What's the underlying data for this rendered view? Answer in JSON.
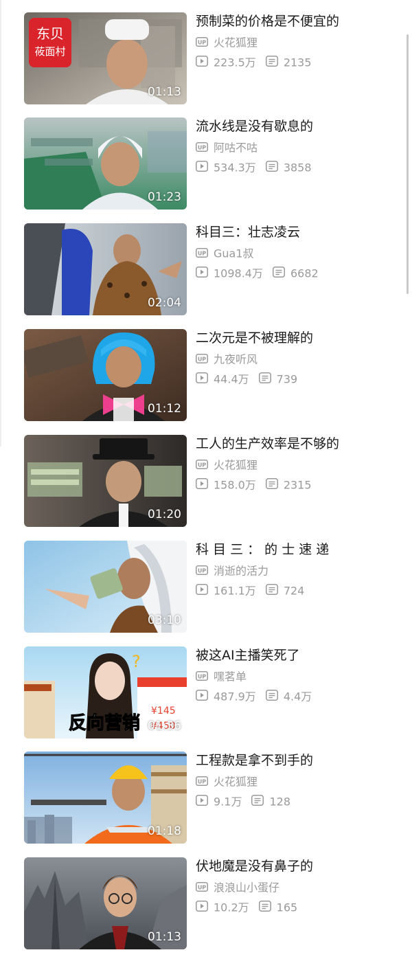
{
  "colors": {
    "title": "#1a1a1a",
    "meta": "#9a9a9a",
    "duration_text": "#ffffff"
  },
  "icons": {
    "uploader": "up-badge-icon",
    "plays": "play-count-icon",
    "comments": "danmaku-count-icon"
  },
  "videos": [
    {
      "title": "预制菜的价格是不便宜的",
      "author": "火花狐狸",
      "plays": "223.5万",
      "comments": "2135",
      "duration": "01:13",
      "thumb_text": "东贝 莜面村"
    },
    {
      "title": "流水线是没有歇息的",
      "author": "阿咕不咕",
      "plays": "534.3万",
      "comments": "3858",
      "duration": "01:23"
    },
    {
      "title": "科目三：壮志凌云",
      "author": "Gua1叔",
      "plays": "1098.4万",
      "comments": "6682",
      "duration": "02:04"
    },
    {
      "title": "二次元是不被理解的",
      "author": "九夜听风",
      "plays": "44.4万",
      "comments": "739",
      "duration": "01:12"
    },
    {
      "title": "工人的生产效率是不够的",
      "author": "火花狐狸",
      "plays": "158.0万",
      "comments": "2315",
      "duration": "01:20"
    },
    {
      "title": "科 目 三 ： 的 士 速 递",
      "author": "消逝的活力",
      "plays": "161.1万",
      "comments": "724",
      "duration": "03:10"
    },
    {
      "title": "被这AI主播笑死了",
      "author": "嘿茗单",
      "plays": "487.9万",
      "comments": "4.4万",
      "duration": "01:36",
      "thumb_text": "反向营销"
    },
    {
      "title": "工程款是拿不到手的",
      "author": "火花狐狸",
      "plays": "9.1万",
      "comments": "128",
      "duration": "01:18"
    },
    {
      "title": "伏地魔是没有鼻子的",
      "author": "浪浪山小蛋仔",
      "plays": "10.2万",
      "comments": "165",
      "duration": "01:13"
    }
  ]
}
